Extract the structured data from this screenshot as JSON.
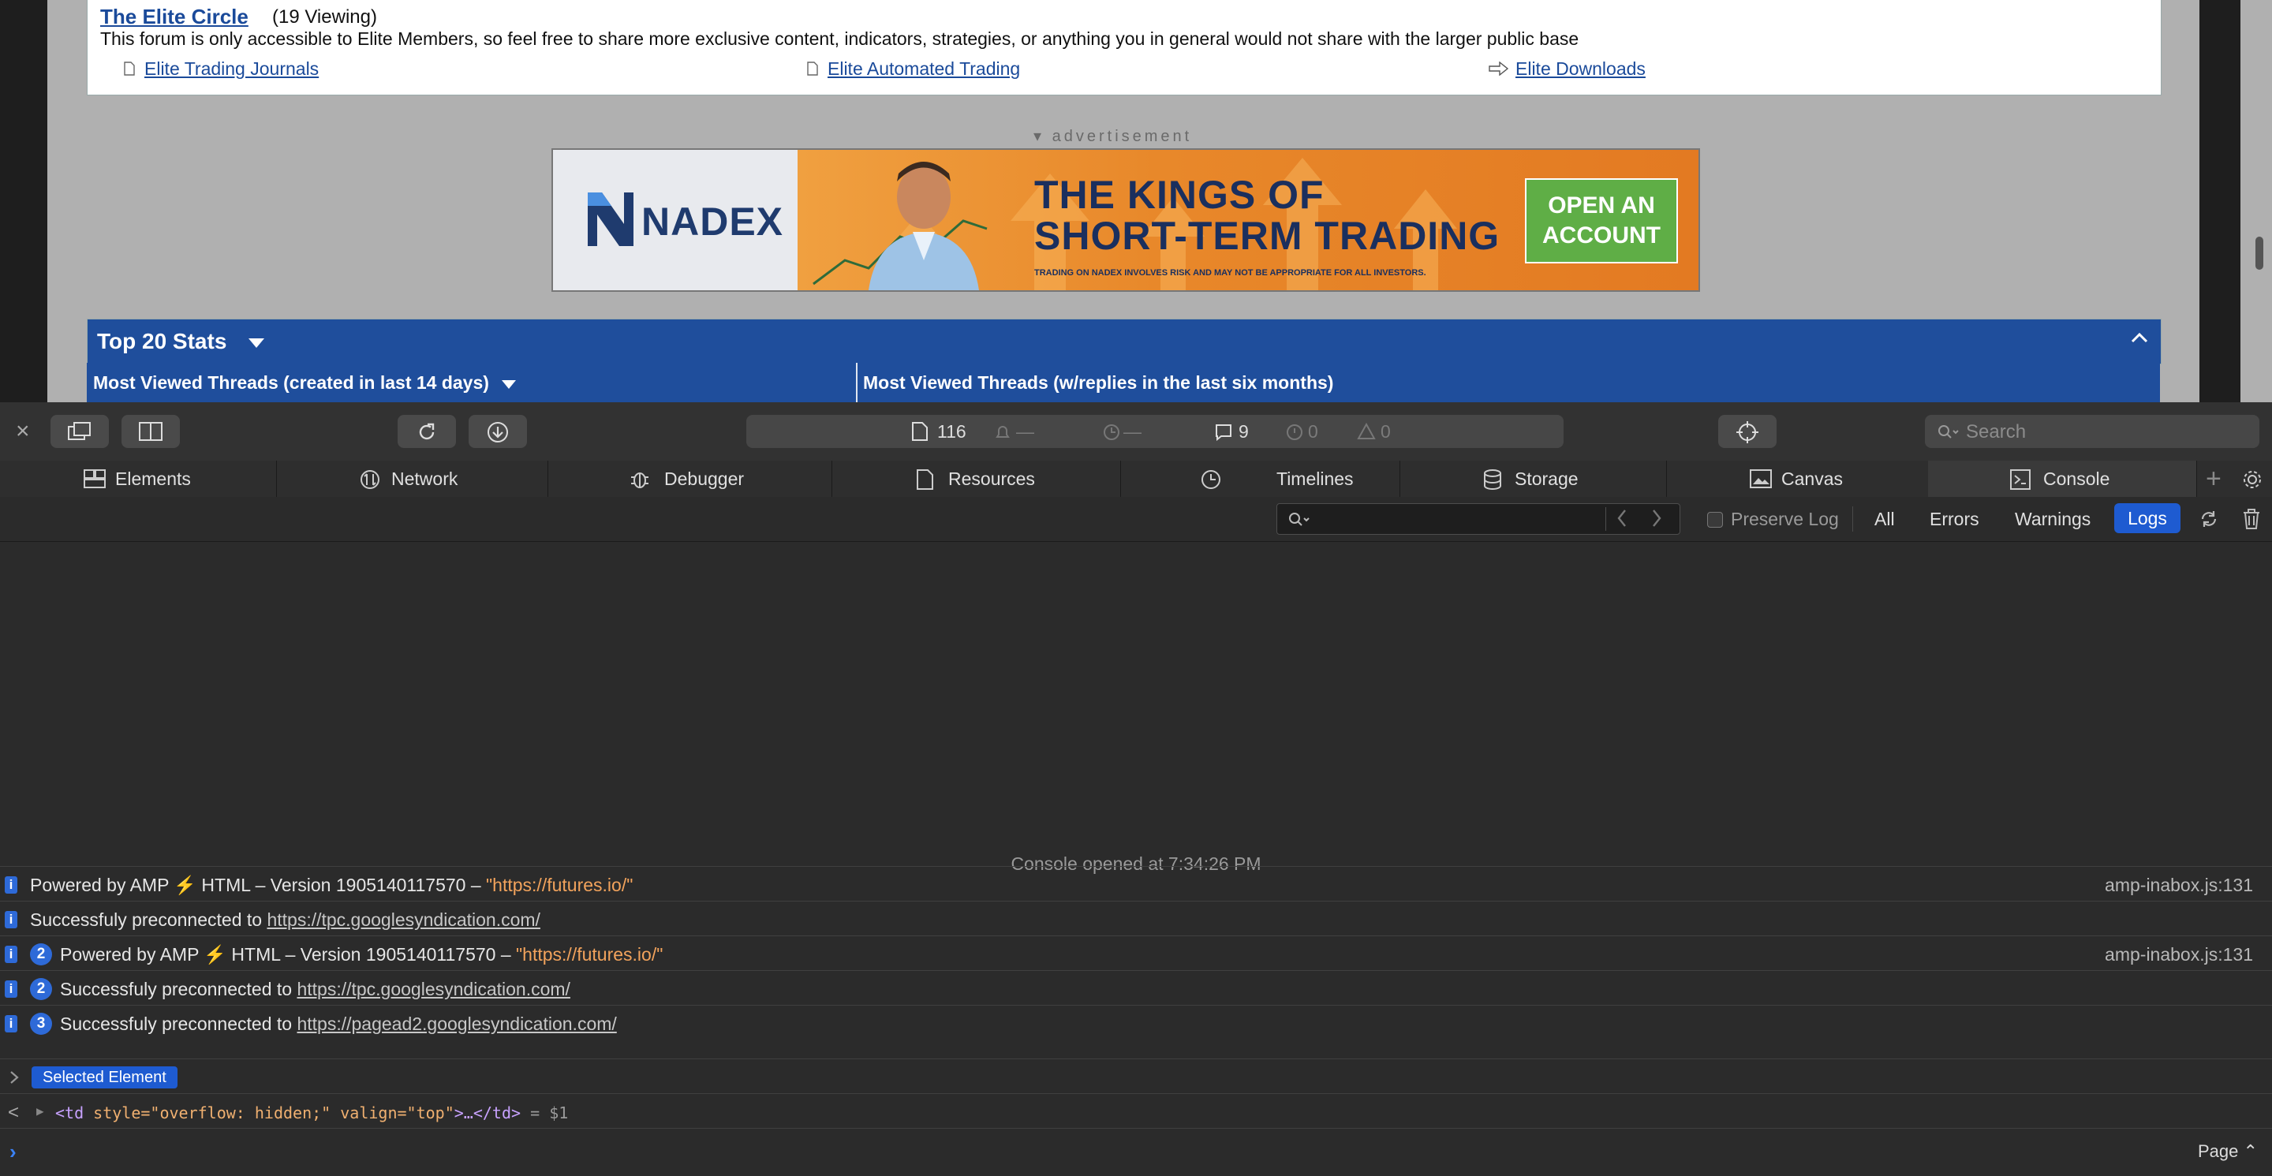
{
  "forum": {
    "title": "The Elite Circle",
    "viewing": "(19 Viewing)",
    "description": "This forum is only accessible to Elite Members, so feel free to share more exclusive content, indicators, strategies, or anything you in general would not share with the larger public base",
    "sublinks": [
      "Elite Trading Journals",
      "Elite Automated Trading",
      "Elite Downloads"
    ]
  },
  "ad": {
    "label": "advertisement",
    "brand": "NADEX",
    "headline_1": "THE KINGS OF",
    "headline_2": "SHORT-TERM TRADING",
    "disclaimer": "TRADING ON NADEX INVOLVES RISK AND MAY NOT BE APPROPRIATE FOR ALL INVESTORS.",
    "cta_1": "OPEN AN",
    "cta_2": "ACCOUNT"
  },
  "stats": {
    "title": "Top 20 Stats",
    "col1": "Most Viewed Threads (created in last 14 days)",
    "col2": "Most Viewed Threads (w/replies in the last six months)"
  },
  "devtools": {
    "activity": {
      "resources": "116",
      "alerts": "—",
      "load_time": "—",
      "logs": "9",
      "errors": "0",
      "warnings": "0"
    },
    "search_placeholder": "Search",
    "tabs": [
      "Elements",
      "Network",
      "Debugger",
      "Resources",
      "Timelines",
      "Storage",
      "Canvas",
      "Console"
    ],
    "filter": {
      "preserve_log": "Preserve Log",
      "levels": [
        "All",
        "Errors",
        "Warnings",
        "Logs"
      ],
      "selected": "Logs"
    },
    "console": {
      "opened": "Console opened at 7:34:26 PM",
      "logs": [
        {
          "count": "",
          "text": "Powered by AMP ⚡ HTML – Version 1905140117570 –",
          "string": "\"https://futures.io/\"",
          "url": "",
          "source": "amp-inabox.js:131"
        },
        {
          "count": "",
          "text": "Successfuly preconnected to",
          "string": "",
          "url": "https://tpc.googlesyndication.com/",
          "source": ""
        },
        {
          "count": "2",
          "text": "Powered by AMP ⚡ HTML – Version 1905140117570 –",
          "string": "\"https://futures.io/\"",
          "url": "",
          "source": "amp-inabox.js:131"
        },
        {
          "count": "2",
          "text": "Successfuly preconnected to",
          "string": "",
          "url": "https://tpc.googlesyndication.com/",
          "source": ""
        },
        {
          "count": "3",
          "text": "Successfuly preconnected to",
          "string": "",
          "url": "https://pagead2.googlesyndication.com/",
          "source": ""
        }
      ],
      "selected_element_badge": "Selected Element",
      "td_open": "<td",
      "td_attr1": "style=",
      "td_val1": "\"overflow: hidden;\"",
      "td_attr2": "valign=",
      "td_val2": "\"top\"",
      "td_close": ">…</td>",
      "td_ref": "= $1",
      "page_selector": "Page ⌃"
    }
  },
  "colors": {
    "accent": "#1e5bd1",
    "forum_header": "#1f4e9c",
    "string": "#f2a35c"
  }
}
